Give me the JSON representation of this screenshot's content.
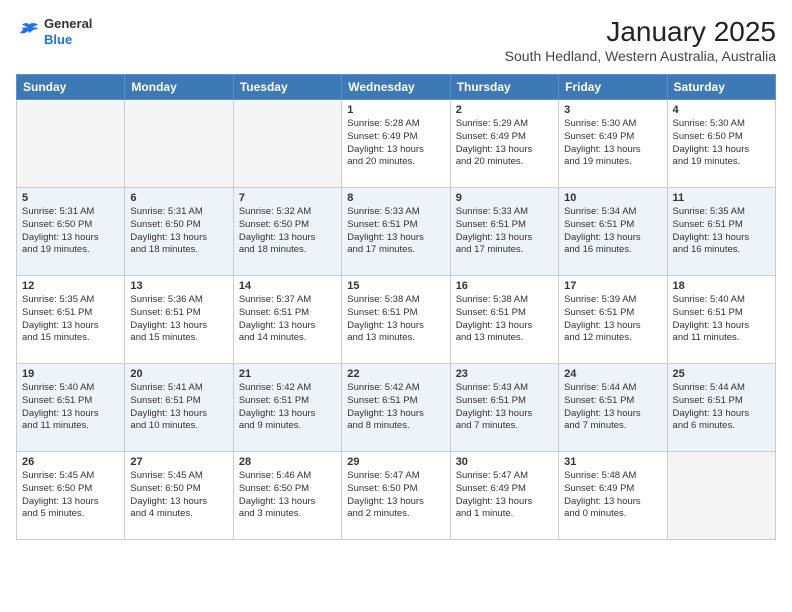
{
  "header": {
    "logo": {
      "general": "General",
      "blue": "Blue"
    },
    "title": "January 2025",
    "subtitle": "South Hedland, Western Australia, Australia"
  },
  "weekdays": [
    "Sunday",
    "Monday",
    "Tuesday",
    "Wednesday",
    "Thursday",
    "Friday",
    "Saturday"
  ],
  "weeks": [
    [
      {
        "day": "",
        "info": ""
      },
      {
        "day": "",
        "info": ""
      },
      {
        "day": "",
        "info": ""
      },
      {
        "day": "1",
        "info": "Sunrise: 5:28 AM\nSunset: 6:49 PM\nDaylight: 13 hours\nand 20 minutes."
      },
      {
        "day": "2",
        "info": "Sunrise: 5:29 AM\nSunset: 6:49 PM\nDaylight: 13 hours\nand 20 minutes."
      },
      {
        "day": "3",
        "info": "Sunrise: 5:30 AM\nSunset: 6:49 PM\nDaylight: 13 hours\nand 19 minutes."
      },
      {
        "day": "4",
        "info": "Sunrise: 5:30 AM\nSunset: 6:50 PM\nDaylight: 13 hours\nand 19 minutes."
      }
    ],
    [
      {
        "day": "5",
        "info": "Sunrise: 5:31 AM\nSunset: 6:50 PM\nDaylight: 13 hours\nand 19 minutes."
      },
      {
        "day": "6",
        "info": "Sunrise: 5:31 AM\nSunset: 6:50 PM\nDaylight: 13 hours\nand 18 minutes."
      },
      {
        "day": "7",
        "info": "Sunrise: 5:32 AM\nSunset: 6:50 PM\nDaylight: 13 hours\nand 18 minutes."
      },
      {
        "day": "8",
        "info": "Sunrise: 5:33 AM\nSunset: 6:51 PM\nDaylight: 13 hours\nand 17 minutes."
      },
      {
        "day": "9",
        "info": "Sunrise: 5:33 AM\nSunset: 6:51 PM\nDaylight: 13 hours\nand 17 minutes."
      },
      {
        "day": "10",
        "info": "Sunrise: 5:34 AM\nSunset: 6:51 PM\nDaylight: 13 hours\nand 16 minutes."
      },
      {
        "day": "11",
        "info": "Sunrise: 5:35 AM\nSunset: 6:51 PM\nDaylight: 13 hours\nand 16 minutes."
      }
    ],
    [
      {
        "day": "12",
        "info": "Sunrise: 5:35 AM\nSunset: 6:51 PM\nDaylight: 13 hours\nand 15 minutes."
      },
      {
        "day": "13",
        "info": "Sunrise: 5:36 AM\nSunset: 6:51 PM\nDaylight: 13 hours\nand 15 minutes."
      },
      {
        "day": "14",
        "info": "Sunrise: 5:37 AM\nSunset: 6:51 PM\nDaylight: 13 hours\nand 14 minutes."
      },
      {
        "day": "15",
        "info": "Sunrise: 5:38 AM\nSunset: 6:51 PM\nDaylight: 13 hours\nand 13 minutes."
      },
      {
        "day": "16",
        "info": "Sunrise: 5:38 AM\nSunset: 6:51 PM\nDaylight: 13 hours\nand 13 minutes."
      },
      {
        "day": "17",
        "info": "Sunrise: 5:39 AM\nSunset: 6:51 PM\nDaylight: 13 hours\nand 12 minutes."
      },
      {
        "day": "18",
        "info": "Sunrise: 5:40 AM\nSunset: 6:51 PM\nDaylight: 13 hours\nand 11 minutes."
      }
    ],
    [
      {
        "day": "19",
        "info": "Sunrise: 5:40 AM\nSunset: 6:51 PM\nDaylight: 13 hours\nand 11 minutes."
      },
      {
        "day": "20",
        "info": "Sunrise: 5:41 AM\nSunset: 6:51 PM\nDaylight: 13 hours\nand 10 minutes."
      },
      {
        "day": "21",
        "info": "Sunrise: 5:42 AM\nSunset: 6:51 PM\nDaylight: 13 hours\nand 9 minutes."
      },
      {
        "day": "22",
        "info": "Sunrise: 5:42 AM\nSunset: 6:51 PM\nDaylight: 13 hours\nand 8 minutes."
      },
      {
        "day": "23",
        "info": "Sunrise: 5:43 AM\nSunset: 6:51 PM\nDaylight: 13 hours\nand 7 minutes."
      },
      {
        "day": "24",
        "info": "Sunrise: 5:44 AM\nSunset: 6:51 PM\nDaylight: 13 hours\nand 7 minutes."
      },
      {
        "day": "25",
        "info": "Sunrise: 5:44 AM\nSunset: 6:51 PM\nDaylight: 13 hours\nand 6 minutes."
      }
    ],
    [
      {
        "day": "26",
        "info": "Sunrise: 5:45 AM\nSunset: 6:50 PM\nDaylight: 13 hours\nand 5 minutes."
      },
      {
        "day": "27",
        "info": "Sunrise: 5:45 AM\nSunset: 6:50 PM\nDaylight: 13 hours\nand 4 minutes."
      },
      {
        "day": "28",
        "info": "Sunrise: 5:46 AM\nSunset: 6:50 PM\nDaylight: 13 hours\nand 3 minutes."
      },
      {
        "day": "29",
        "info": "Sunrise: 5:47 AM\nSunset: 6:50 PM\nDaylight: 13 hours\nand 2 minutes."
      },
      {
        "day": "30",
        "info": "Sunrise: 5:47 AM\nSunset: 6:49 PM\nDaylight: 13 hours\nand 1 minute."
      },
      {
        "day": "31",
        "info": "Sunrise: 5:48 AM\nSunset: 6:49 PM\nDaylight: 13 hours\nand 0 minutes."
      },
      {
        "day": "",
        "info": ""
      }
    ]
  ]
}
